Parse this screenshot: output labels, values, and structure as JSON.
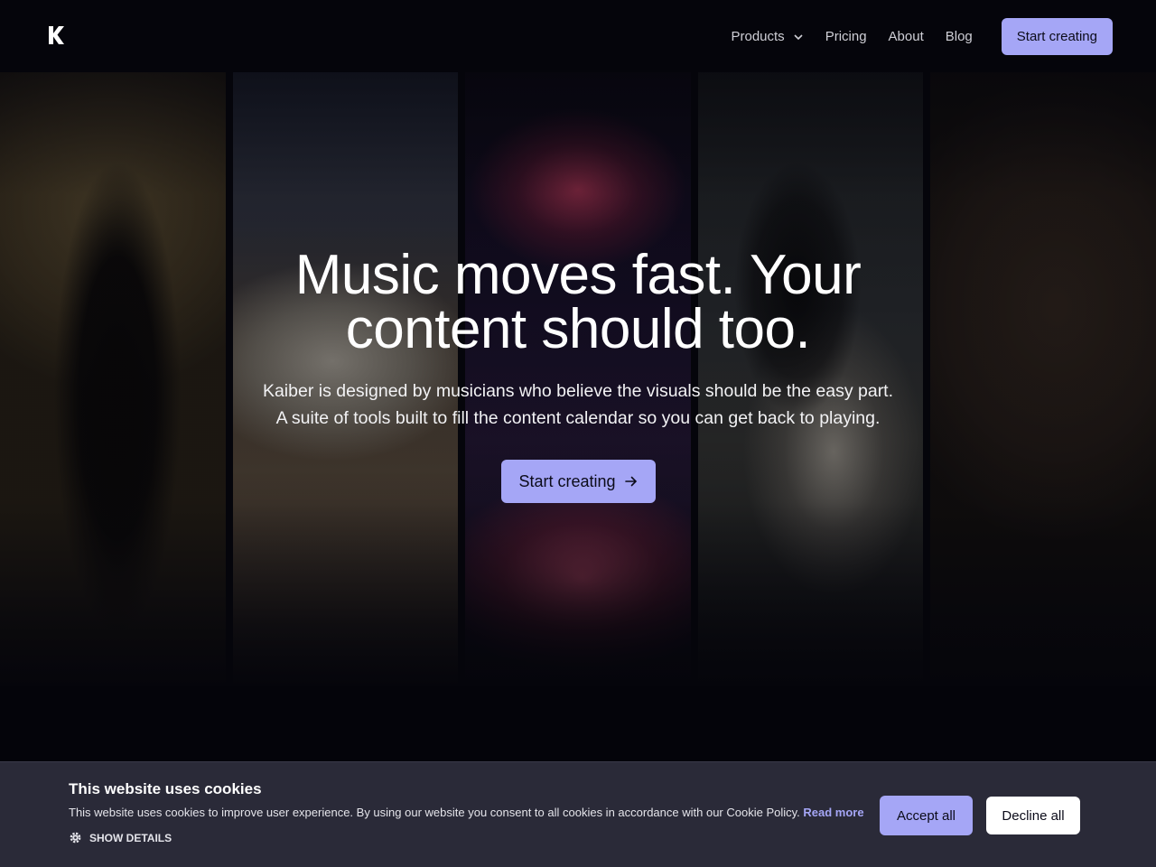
{
  "nav": {
    "logo_icon": "kaiber-k-logo-icon",
    "links": [
      {
        "label": "Products",
        "has_dropdown": true
      },
      {
        "label": "Pricing"
      },
      {
        "label": "About"
      },
      {
        "label": "Blog"
      }
    ],
    "cta_label": "Start creating"
  },
  "hero": {
    "headline_line1": "Music moves fast. Your",
    "headline_line2": "content should too.",
    "sub_line1": "Kaiber is designed by musicians who believe the visuals should be the easy part.",
    "sub_line2": "A suite of tools built to fill the content calendar so you can get back to playing.",
    "cta_label": "Start creating",
    "cta_icon": "arrow-right-icon"
  },
  "cookie": {
    "title": "This website uses cookies",
    "text": "This website uses cookies to improve user experience. By using our website you consent to all cookies in accordance with our Cookie Policy.",
    "read_more": "Read more",
    "show_details": "SHOW DETAILS",
    "accept_label": "Accept all",
    "decline_label": "Decline all"
  },
  "colors": {
    "accent": "#a5a6f6",
    "background": "#05050b",
    "cookie_bg": "#2a2a38"
  }
}
